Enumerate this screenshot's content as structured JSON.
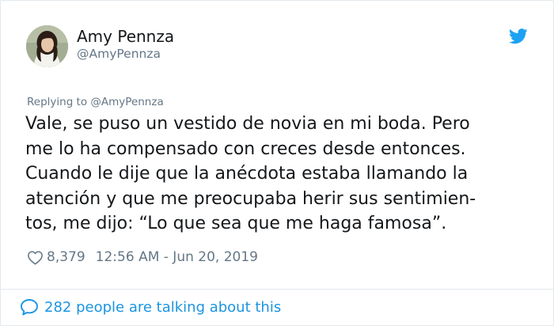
{
  "user": {
    "display_name": "Amy Pennza",
    "handle": "@AmyPennza",
    "avatar_icon": "profile-photo"
  },
  "reply": {
    "prefix": "Replying to ",
    "mention": "@AmyPennza"
  },
  "tweet": {
    "lines": [
      "Vale, se puso un vestido de novia en mi boda. Pero",
      "me lo ha compensado con creces desde entonces.",
      "Cuando le dije que la anécdota estaba llamando la",
      "atención y que me preocupaba herir sus sentimien-",
      "tos, me dijo: “Lo que sea que me haga famosa”."
    ]
  },
  "meta": {
    "likes": "8,379",
    "timestamp": "12:56 AM - Jun 20, 2019",
    "like_icon": "heart-outline-icon"
  },
  "footer": {
    "talking_label": "282 people are talking about this",
    "icon": "speech-bubble-icon"
  },
  "colors": {
    "twitter_blue": "#1da1f2",
    "link_blue": "#1b95e0",
    "secondary_text": "#657786",
    "primary_text": "#14171a",
    "border": "#e1e8ed"
  }
}
